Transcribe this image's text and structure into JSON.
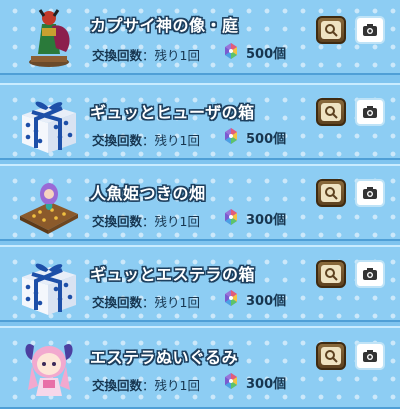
{
  "items": [
    {
      "name": "カプサイ神の像・庭",
      "count_label": "交換回数",
      "count_value": "残り1回",
      "price": "500個",
      "thumb_icon": "statue-icon"
    },
    {
      "name": "ギュッとヒューザの箱",
      "count_label": "交換回数",
      "count_value": "残り1回",
      "price": "500個",
      "thumb_icon": "gift-box-icon"
    },
    {
      "name": "人魚姫つきの畑",
      "count_label": "交換回数",
      "count_value": "残り1回",
      "price": "300個",
      "thumb_icon": "mermaid-field-icon"
    },
    {
      "name": "ギュッとエステラの箱",
      "count_label": "交換回数",
      "count_value": "残り1回",
      "price": "300個",
      "thumb_icon": "gift-box-icon"
    },
    {
      "name": "エステラぬいぐるみ",
      "count_label": "交換回数",
      "count_value": "残り1回",
      "price": "300個",
      "thumb_icon": "plush-doll-icon"
    }
  ],
  "currency_icon": "rainbow-gem-icon",
  "colors": {
    "row_bg": "#8dcdf3",
    "title_text": "#ffffff",
    "title_outline": "#1d3f5e",
    "body_text": "#173650"
  }
}
